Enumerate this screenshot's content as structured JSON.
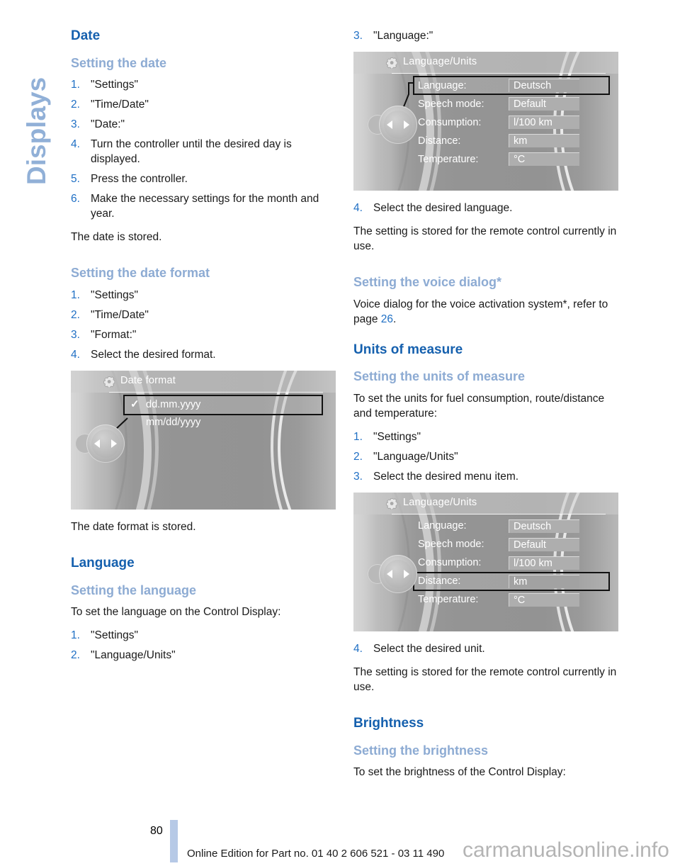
{
  "chapter": {
    "label": "Displays"
  },
  "left_column": {
    "section_date": "Date",
    "sub_setting_date": "Setting the date",
    "steps_date": [
      "\"Settings\"",
      "\"Time/Date\"",
      "\"Date:\"",
      "Turn the controller until the desired day is displayed.",
      "Press the controller.",
      "Make the necessary settings for the month and year."
    ],
    "date_stored": "The date is stored.",
    "sub_setting_date_format": "Setting the date format",
    "steps_date_format": [
      "\"Settings\"",
      "\"Time/Date\"",
      "\"Format:\"",
      "Select the desired format."
    ],
    "date_format_stored": "The date format is stored.",
    "section_language": "Language",
    "sub_setting_language": "Setting the language",
    "language_intro": "To set the language on the Control Display:",
    "steps_language": [
      "\"Settings\"",
      "\"Language/Units\""
    ]
  },
  "right_column": {
    "step3_language": {
      "num": "3.",
      "text": "\"Language:\""
    },
    "step4_language": {
      "num": "4.",
      "text": "Select the desired language."
    },
    "stored_language": "The setting is stored for the remote control currently in use.",
    "sub_voice_dialog": "Setting the voice dialog*",
    "voice_dialog_text_before": "Voice dialog for the voice activation system*, refer to page ",
    "voice_dialog_page": "26",
    "voice_dialog_text_after": ".",
    "section_units": "Units of measure",
    "sub_setting_units": "Setting the units of measure",
    "units_intro": "To set the units for fuel consumption, route/distance and temperature:",
    "steps_units": [
      "\"Settings\"",
      "\"Language/Units\"",
      "Select the desired menu item."
    ],
    "step4_unit": {
      "num": "4.",
      "text": "Select the desired unit."
    },
    "stored_unit": "The setting is stored for the remote control currently in use.",
    "section_brightness": "Brightness",
    "sub_setting_brightness": "Setting the brightness",
    "brightness_intro": "To set the brightness of the Control Display:"
  },
  "screens": {
    "date_format": {
      "icon": "gear-icon",
      "title": "Date format",
      "items": [
        {
          "label": "dd.mm.yyyy",
          "checked": true,
          "selected": true,
          "check_glyph": "✓"
        },
        {
          "label": "mm/dd/yyyy",
          "checked": false,
          "selected": false,
          "check_glyph": ""
        }
      ]
    },
    "language_units_top": {
      "icon": "gear-icon",
      "title": "Language/Units",
      "rows": [
        {
          "label": "Language:",
          "value": "Deutsch",
          "selected": true
        },
        {
          "label": "Speech mode:",
          "value": "Default",
          "selected": false
        },
        {
          "label": "Consumption:",
          "value": "l/100 km",
          "selected": false
        },
        {
          "label": "Distance:",
          "value": "km",
          "selected": false
        },
        {
          "label": "Temperature:",
          "value": "°C",
          "selected": false
        }
      ]
    },
    "language_units_bottom": {
      "icon": "gear-icon",
      "title": "Language/Units",
      "rows": [
        {
          "label": "Language:",
          "value": "Deutsch",
          "selected": false
        },
        {
          "label": "Speech mode:",
          "value": "Default",
          "selected": false
        },
        {
          "label": "Consumption:",
          "value": "l/100 km",
          "selected": false
        },
        {
          "label": "Distance:",
          "value": "km",
          "selected": true
        },
        {
          "label": "Temperature:",
          "value": "°C",
          "selected": false
        }
      ]
    }
  },
  "footer": {
    "page_number": "80",
    "edition_text": "Online Edition for Part no. 01 40 2 606 521 - 03 11 490",
    "watermark": "carmanualsonline.info"
  },
  "colors": {
    "heading": "#1560ae",
    "subheading": "#8dabd3",
    "chapter_tab": "#91b0d7",
    "link": "#1f6fc4",
    "page_marker": "#b6c9e6"
  }
}
